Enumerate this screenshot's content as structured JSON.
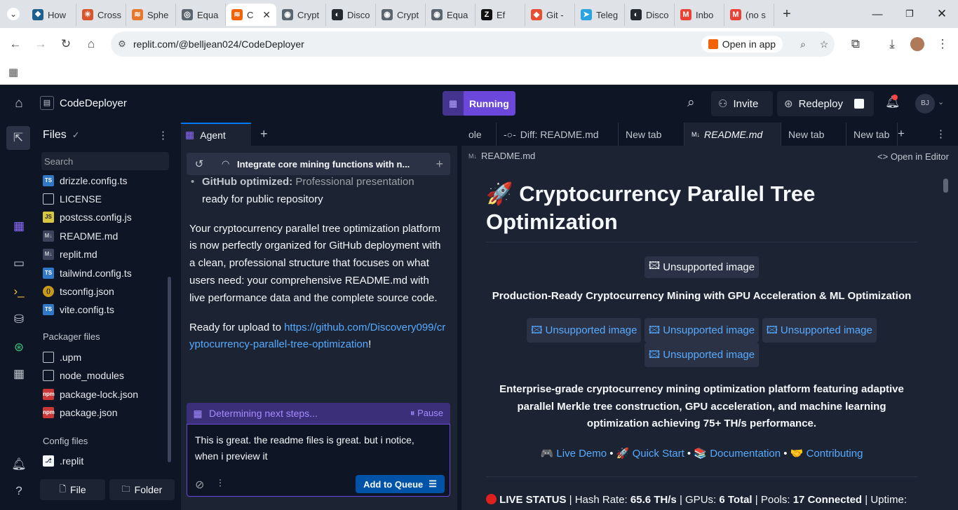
{
  "browser": {
    "tabs": [
      {
        "title": "How",
        "favicon_color": "#1f5f8b",
        "glyph": "❖"
      },
      {
        "title": "Cross",
        "favicon_color": "#d9542b",
        "glyph": "✳"
      },
      {
        "title": "Sphe",
        "favicon_color": "#e8772e",
        "glyph": "≋"
      },
      {
        "title": "Equa",
        "favicon_color": "#5b6570",
        "glyph": "◎"
      },
      {
        "title": "C",
        "favicon_color": "#f26207",
        "glyph": "≋",
        "active": true
      },
      {
        "title": "Crypt",
        "favicon_color": "#5b6570",
        "glyph": "◉"
      },
      {
        "title": "Disco",
        "favicon_color": "#24292f",
        "glyph": "◐"
      },
      {
        "title": "Crypt",
        "favicon_color": "#5b6570",
        "glyph": "◉"
      },
      {
        "title": "Equa",
        "favicon_color": "#5b6570",
        "glyph": "◉"
      },
      {
        "title": "Ef",
        "favicon_color": "#111111",
        "glyph": "Z"
      },
      {
        "title": "Git -",
        "favicon_color": "#e84e31",
        "glyph": "◆"
      },
      {
        "title": "Teleg",
        "favicon_color": "#2aa3df",
        "glyph": "➤"
      },
      {
        "title": "Disco",
        "favicon_color": "#24292f",
        "glyph": "◐"
      },
      {
        "title": "Inbo",
        "favicon_color": "#ea4335",
        "glyph": "M"
      },
      {
        "title": "(no s",
        "favicon_color": "#ea4335",
        "glyph": "M"
      }
    ],
    "url": "replit.com/@belljean024/CodeDeployer",
    "open_in_app": "Open in app"
  },
  "topbar": {
    "project": "CodeDeployer",
    "run_label": "Running",
    "invite": "Invite",
    "redeploy": "Redeploy",
    "avatar": "BJ"
  },
  "files": {
    "title": "Files",
    "search_placeholder": "Search",
    "items": [
      {
        "name": "drizzle.config.ts",
        "type": "TS"
      },
      {
        "name": "LICENSE",
        "type": "doc"
      },
      {
        "name": "postcss.config.js",
        "type": "JS"
      },
      {
        "name": "README.md",
        "type": "MD"
      },
      {
        "name": "replit.md",
        "type": "MD"
      },
      {
        "name": "tailwind.config.ts",
        "type": "TS"
      },
      {
        "name": "tsconfig.json",
        "type": "json"
      },
      {
        "name": "vite.config.ts",
        "type": "TS"
      }
    ],
    "packager_title": "Packager files",
    "packager": [
      {
        "name": ".upm",
        "type": "folder"
      },
      {
        "name": "node_modules",
        "type": "folder"
      },
      {
        "name": "package-lock.json",
        "type": "npm"
      },
      {
        "name": "package.json",
        "type": "npm"
      }
    ],
    "config_title": "Config files",
    "config": [
      {
        "name": ".replit",
        "type": "replit"
      }
    ],
    "new_file": "File",
    "new_folder": "Folder"
  },
  "agent": {
    "tab": "Agent",
    "task": "Integrate core mining functions with n...",
    "bullet_bold": "GitHub optimized:",
    "bullet_rest": "Professional presentation",
    "bullet_rest2": "ready for public repository",
    "para1": "Your cryptocurrency parallel tree optimization platform is now perfectly organized for GitHub deployment with a clean, professional structure that focuses on what users need: your comprehensive README.md with live performance data and the complete source code.",
    "para2_prefix": "Ready for upload to",
    "para2_link": "https://github.com/Discovery099/cryptocurrency-parallel-tree-optimization",
    "para2_suffix": "!",
    "status": "Determining next steps...",
    "pause": "Pause",
    "input_text": "This is great. the readme files is great. but i notice, when i preview it",
    "add_queue": "Add to Queue"
  },
  "viewer": {
    "tabs": [
      "ole",
      "Diff: README.md",
      "New tab",
      "README.md",
      "New tab",
      "New tab"
    ],
    "file_label": "README.md",
    "open_in_editor": "Open in Editor",
    "title_line1": "Cryptocurrency Parallel Tree",
    "title_line2": "Optimization",
    "title_emoji": "🚀",
    "unsupported": "Unsupported image",
    "subtitle": "Production-Ready Cryptocurrency Mining with GPU Acceleration & ML Optimization",
    "description": "Enterprise-grade cryptocurrency mining optimization platform featuring adaptive parallel Merkle tree construction, GPU acceleration, and machine learning optimization achieving 75+ TH/s performance.",
    "links": [
      {
        "emoji": "🎮",
        "label": "Live Demo"
      },
      {
        "emoji": "🚀",
        "label": "Quick Start"
      },
      {
        "emoji": "📚",
        "label": "Documentation"
      },
      {
        "emoji": "🤝",
        "label": "Contributing"
      }
    ],
    "status_line": {
      "label": "LIVE STATUS",
      "hash_label": "Hash Rate:",
      "hash_value": "65.6 TH/s",
      "gpu_label": "GPUs:",
      "gpu_value": "6 Total",
      "pools_label": "Pools:",
      "pools_value": "17 Connected",
      "uptime_label": "Uptime:"
    }
  }
}
